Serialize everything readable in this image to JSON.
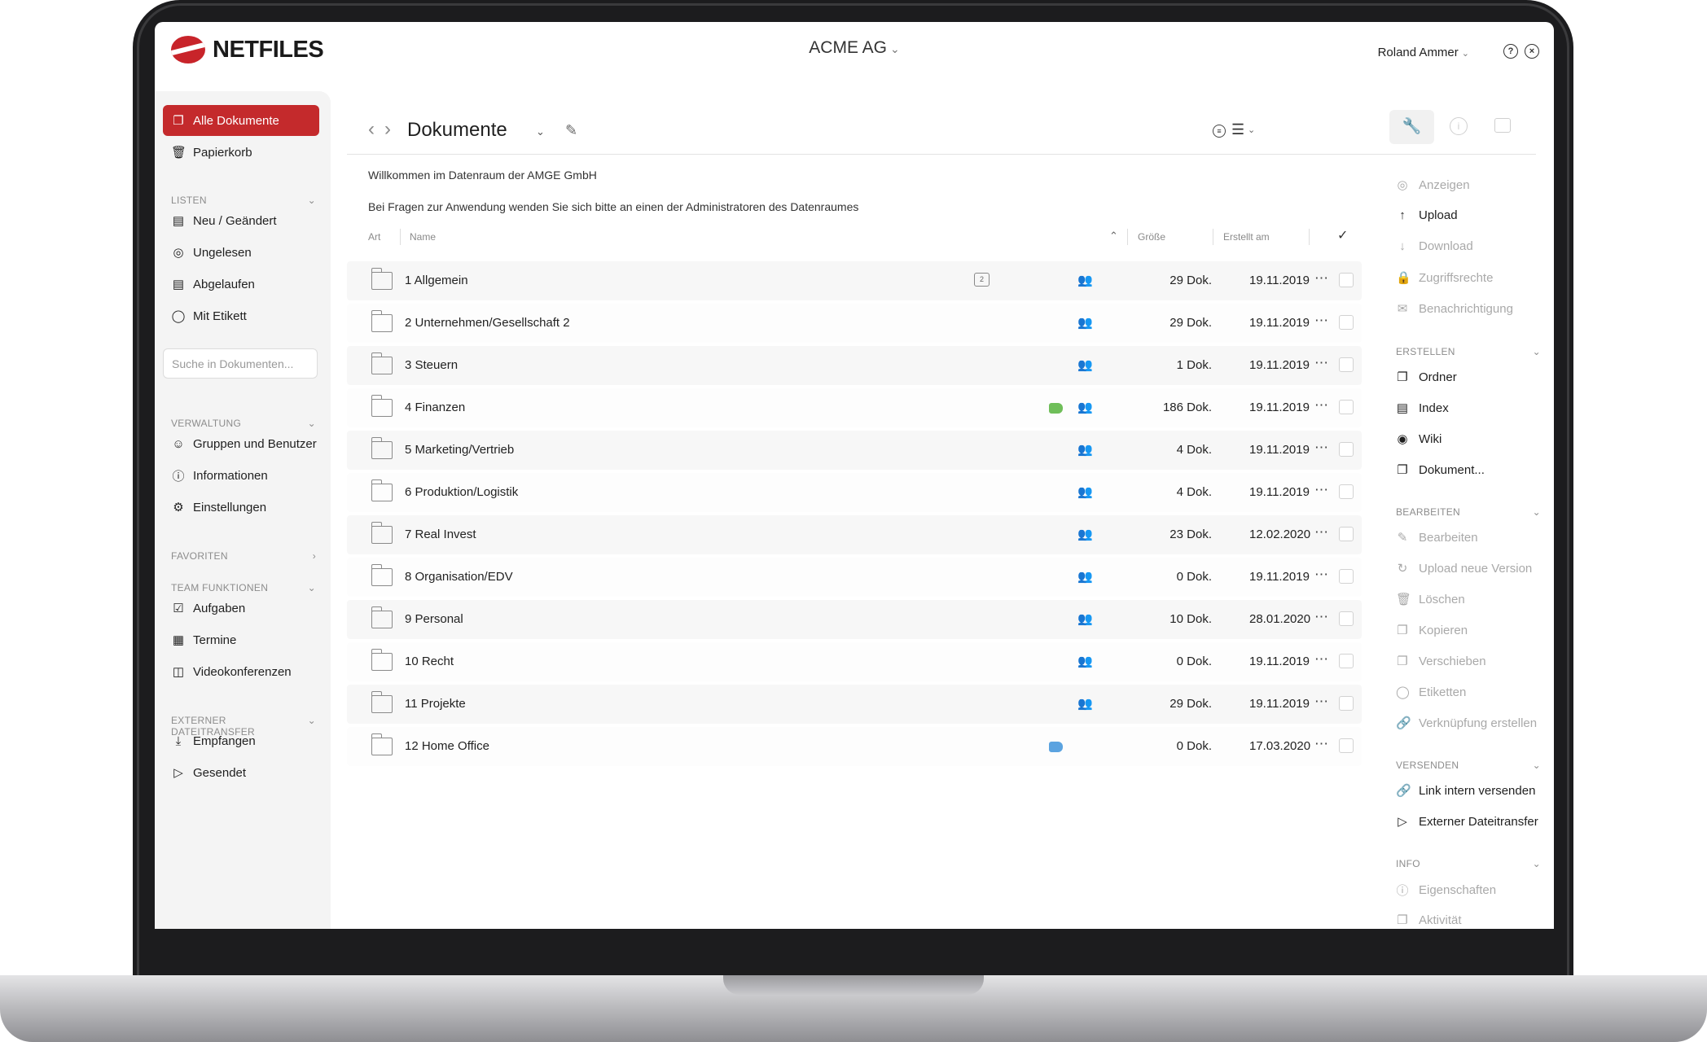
{
  "app": {
    "logo": "NETFILES",
    "company": "ACME AG",
    "user": "Roland Ammer"
  },
  "sidebar": {
    "main_items": [
      {
        "label": "Alle Dokumente",
        "icon": "documents-icon",
        "active": true
      },
      {
        "label": "Papierkorb",
        "icon": "trash-icon"
      }
    ],
    "listen": {
      "heading": "LISTEN",
      "items": [
        {
          "label": "Neu / Geändert",
          "icon": "list-doc-icon"
        },
        {
          "label": "Ungelesen",
          "icon": "unread-icon"
        },
        {
          "label": "Abgelaufen",
          "icon": "expired-icon"
        },
        {
          "label": "Mit Etikett",
          "icon": "tag-icon"
        }
      ]
    },
    "search_placeholder": "Suche in Dokumenten...",
    "verwaltung": {
      "heading": "VERWALTUNG",
      "items": [
        {
          "label": "Gruppen und Benutzer",
          "icon": "users-icon"
        },
        {
          "label": "Informationen",
          "icon": "info-icon"
        },
        {
          "label": "Einstellungen",
          "icon": "gear-icon"
        }
      ]
    },
    "favoriten": {
      "heading": "FAVORITEN"
    },
    "team": {
      "heading": "TEAM FUNKTIONEN",
      "items": [
        {
          "label": "Aufgaben",
          "icon": "task-icon"
        },
        {
          "label": "Termine",
          "icon": "calendar-icon"
        },
        {
          "label": "Videokonferenzen",
          "icon": "video-icon"
        }
      ]
    },
    "transfer": {
      "heading": "EXTERNER DATEITRANSFER",
      "items": [
        {
          "label": "Empfangen",
          "icon": "download-icon"
        },
        {
          "label": "Gesendet",
          "icon": "send-icon"
        }
      ]
    }
  },
  "main": {
    "title": "Dokumente",
    "welcome": "Willkommen im Datenraum der AMGE GmbH",
    "question": "Bei Fragen zur Anwendung wenden Sie sich bitte an einen der Administratoren des Datenraumes",
    "columns": {
      "art": "Art",
      "name": "Name",
      "size": "Größe",
      "created": "Erstellt am"
    },
    "rows": [
      {
        "name": "1 Allgemein",
        "comments": "2",
        "tag": "",
        "shared": true,
        "size": "29 Dok.",
        "date": "19.11.2019"
      },
      {
        "name": "2 Unternehmen/Gesellschaft 2",
        "comments": "",
        "tag": "",
        "shared": true,
        "size": "29 Dok.",
        "date": "19.11.2019"
      },
      {
        "name": "3 Steuern",
        "comments": "",
        "tag": "",
        "shared": true,
        "size": "1 Dok.",
        "date": "19.11.2019"
      },
      {
        "name": "4 Finanzen",
        "comments": "",
        "tag": "#6fbe59",
        "shared": true,
        "size": "186 Dok.",
        "date": "19.11.2019"
      },
      {
        "name": "5 Marketing/Vertrieb",
        "comments": "",
        "tag": "",
        "shared": true,
        "size": "4 Dok.",
        "date": "19.11.2019"
      },
      {
        "name": "6 Produktion/Logistik",
        "comments": "",
        "tag": "",
        "shared": true,
        "size": "4 Dok.",
        "date": "19.11.2019"
      },
      {
        "name": "7 Real Invest",
        "comments": "",
        "tag": "",
        "shared": true,
        "size": "23 Dok.",
        "date": "12.02.2020"
      },
      {
        "name": "8 Organisation/EDV",
        "comments": "",
        "tag": "",
        "shared": true,
        "size": "0 Dok.",
        "date": "19.11.2019"
      },
      {
        "name": "9 Personal",
        "comments": "",
        "tag": "",
        "shared": true,
        "size": "10 Dok.",
        "date": "28.01.2020"
      },
      {
        "name": "10 Recht",
        "comments": "",
        "tag": "",
        "shared": true,
        "size": "0 Dok.",
        "date": "19.11.2019"
      },
      {
        "name": "11 Projekte",
        "comments": "",
        "tag": "",
        "shared": true,
        "size": "29 Dok.",
        "date": "19.11.2019"
      },
      {
        "name": "12 Home Office",
        "comments": "",
        "tag": "#5ba3e0",
        "shared": false,
        "size": "0 Dok.",
        "date": "17.03.2020"
      }
    ]
  },
  "right_panel": {
    "top_items": [
      {
        "label": "Anzeigen",
        "icon": "view-icon",
        "enabled": false
      },
      {
        "label": "Upload",
        "icon": "upload-icon",
        "enabled": true
      },
      {
        "label": "Download",
        "icon": "download-icon",
        "enabled": false
      },
      {
        "label": "Zugriffsrechte",
        "icon": "lock-icon",
        "enabled": false
      },
      {
        "label": "Benachrichtigung",
        "icon": "mail-icon",
        "enabled": false
      }
    ],
    "erstellen": {
      "heading": "ERSTELLEN",
      "items": [
        {
          "label": "Ordner",
          "icon": "new-folder-icon",
          "enabled": true
        },
        {
          "label": "Index",
          "icon": "index-icon",
          "enabled": true
        },
        {
          "label": "Wiki",
          "icon": "wiki-icon",
          "enabled": true
        },
        {
          "label": "Dokument...",
          "icon": "new-document-icon",
          "enabled": true
        }
      ]
    },
    "bearbeiten": {
      "heading": "BEARBEITEN",
      "items": [
        {
          "label": "Bearbeiten",
          "icon": "pencil-icon",
          "enabled": false
        },
        {
          "label": "Upload neue Version",
          "icon": "upload-version-icon",
          "enabled": false
        },
        {
          "label": "Löschen",
          "icon": "trash-icon",
          "enabled": false
        },
        {
          "label": "Kopieren",
          "icon": "copy-icon",
          "enabled": false
        },
        {
          "label": "Verschieben",
          "icon": "move-icon",
          "enabled": false
        },
        {
          "label": "Etiketten",
          "icon": "tag-icon",
          "enabled": false
        },
        {
          "label": "Verknüpfung erstellen",
          "icon": "link-icon",
          "enabled": false
        }
      ]
    },
    "versenden": {
      "heading": "VERSENDEN",
      "items": [
        {
          "label": "Link intern versenden",
          "icon": "link-icon",
          "enabled": true
        },
        {
          "label": "Externer Dateitransfer",
          "icon": "send-icon",
          "enabled": true
        }
      ]
    },
    "info": {
      "heading": "INFO",
      "items": [
        {
          "label": "Eigenschaften",
          "icon": "info-icon",
          "enabled": false
        },
        {
          "label": "Aktivität",
          "icon": "activity-icon",
          "enabled": false
        }
      ]
    }
  },
  "colors": {
    "accent": "#c42a2c",
    "tag_green": "#6fbe59",
    "tag_blue": "#5ba3e0"
  }
}
